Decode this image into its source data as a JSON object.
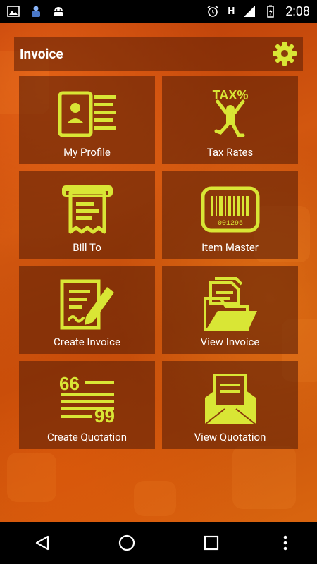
{
  "status_bar": {
    "time": "2:08",
    "network_type": "H",
    "icons": [
      "image-icon",
      "person-icon",
      "android-icon",
      "alarm-icon",
      "signal-icon",
      "battery-icon"
    ]
  },
  "app_bar": {
    "title": "Invoice",
    "settings_icon": "gear-icon"
  },
  "tiles": [
    {
      "label": "My Profile",
      "icon": "profile-card-icon"
    },
    {
      "label": "Tax Rates",
      "icon": "tax-person-icon"
    },
    {
      "label": "Bill To",
      "icon": "receipt-icon"
    },
    {
      "label": "Item Master",
      "icon": "barcode-icon"
    },
    {
      "label": "Create Invoice",
      "icon": "document-pen-icon"
    },
    {
      "label": "View Invoice",
      "icon": "folder-documents-icon"
    },
    {
      "label": "Create Quotation",
      "icon": "quote-text-icon"
    },
    {
      "label": "View Quotation",
      "icon": "envelope-letter-icon"
    }
  ],
  "icon_text": {
    "tax": "TAX%",
    "barcode_number": "001295",
    "quote_open": "66",
    "quote_close": "99"
  },
  "colors": {
    "icon_accent": "#d9e635",
    "background_orange": "#c9500c",
    "tile_overlay": "#5f2006"
  },
  "nav_bar": {
    "buttons": [
      "back-icon",
      "home-icon",
      "recents-icon",
      "more-icon"
    ]
  }
}
